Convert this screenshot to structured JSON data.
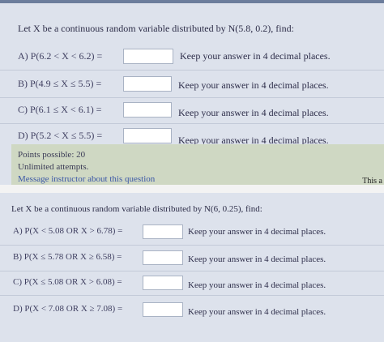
{
  "top": {
    "question": "Let X be a continuous random variable distributed by N(5.8, 0.2), find:",
    "items": [
      {
        "label": "A) P(6.2 < X < 6.2) =",
        "hint": "Keep your answer in 4 decimal places."
      },
      {
        "label": "B) P(4.9 ≤ X ≤ 5.5) =",
        "hint": "Keep your answer in 4 decimal places."
      },
      {
        "label": "C) P(6.1 ≤ X < 6.1) =",
        "hint": "Keep your answer in 4 decimal places."
      },
      {
        "label": "D) P(5.2 < X ≤ 5.5) =",
        "hint": "Keep your answer in 4 decimal places."
      }
    ],
    "footer": {
      "points": "Points possible: 20",
      "attempts": "Unlimited attempts.",
      "link": "Message instructor about this question"
    }
  },
  "corner_text": "This a",
  "bottom": {
    "question": "Let X be a continuous random variable distributed by N(6, 0.25), find:",
    "items": [
      {
        "label": "A) P(X < 5.08 OR X > 6.78) =",
        "hint": "Keep your answer in 4 decimal places."
      },
      {
        "label": "B) P(X ≤ 5.78 OR X ≥ 6.58) =",
        "hint": "Keep your answer in 4 decimal places."
      },
      {
        "label": "C) P(X ≤ 5.08 OR X > 6.08) =",
        "hint": "Keep your answer in 4 decimal places."
      },
      {
        "label": "D) P(X < 7.08 OR X ≥ 7.08) =",
        "hint": "Keep your answer in 4 decimal places."
      }
    ]
  }
}
